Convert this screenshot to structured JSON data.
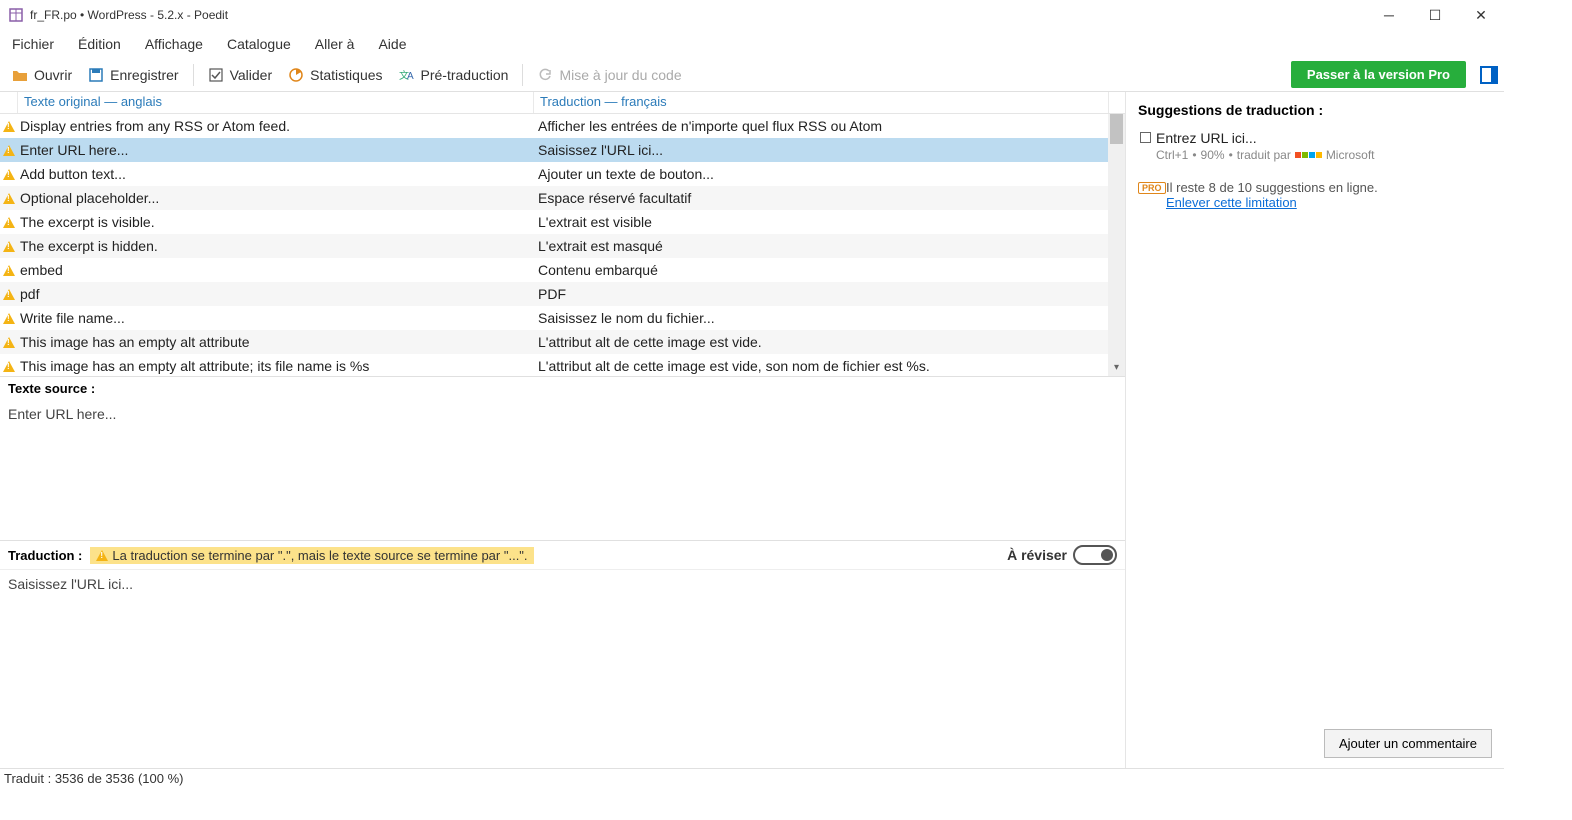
{
  "title": "fr_FR.po • WordPress - 5.2.x - Poedit",
  "menus": {
    "file": "Fichier",
    "edit": "Édition",
    "view": "Affichage",
    "catalog": "Catalogue",
    "goto": "Aller à",
    "help": "Aide"
  },
  "toolbar": {
    "open": "Ouvrir",
    "save": "Enregistrer",
    "validate": "Valider",
    "stats": "Statistiques",
    "pretranslate": "Pré-traduction",
    "update": "Mise à jour du code",
    "pro": "Passer à la version Pro"
  },
  "grid": {
    "header_source": "Texte original — anglais",
    "header_translation": "Traduction — français",
    "rows": [
      {
        "src": "Display entries from any RSS or Atom feed.",
        "tr": "Afficher les entrées de n'importe quel flux RSS ou Atom"
      },
      {
        "src": "Enter URL here...",
        "tr": "Saisissez l'URL ici...",
        "selected": true
      },
      {
        "src": "Add button text...",
        "tr": "Ajouter un texte de bouton..."
      },
      {
        "src": "Optional placeholder...",
        "tr": "Espace réservé facultatif"
      },
      {
        "src": "The excerpt is visible.",
        "tr": "L'extrait est visible"
      },
      {
        "src": "The excerpt is hidden.",
        "tr": "L'extrait est masqué"
      },
      {
        "src": "embed",
        "tr": "Contenu embarqué"
      },
      {
        "src": "pdf",
        "tr": "PDF"
      },
      {
        "src": "Write file name...",
        "tr": "Saisissez le nom du fichier..."
      },
      {
        "src": "This image has an empty alt attribute",
        "tr": "L'attribut alt de cette image est vide."
      },
      {
        "src": "This image has an empty alt attribute; its file name is %s",
        "tr": "L'attribut alt de cette image est vide, son nom de fichier est %s."
      }
    ]
  },
  "source_panel": {
    "label": "Texte source :",
    "text": "Enter URL here..."
  },
  "translation_panel": {
    "label": "Traduction :",
    "warning": "La traduction se termine par \".\", mais le texte source se termine par \"...\".",
    "review_label": "À réviser",
    "text": "Saisissez l'URL ici..."
  },
  "sidebar": {
    "title": "Suggestions de traduction :",
    "suggestion": {
      "text": "Entrez URL ici...",
      "shortcut": "Ctrl+1",
      "score": "90%",
      "by": "traduit par",
      "provider": "Microsoft"
    },
    "pro_badge": "PRO",
    "pro_msg": "Il reste 8 de 10 suggestions en ligne.",
    "pro_link": "Enlever cette limitation",
    "add_comment": "Ajouter un commentaire"
  },
  "status": "Traduit : 3536 de 3536 (100 %)"
}
